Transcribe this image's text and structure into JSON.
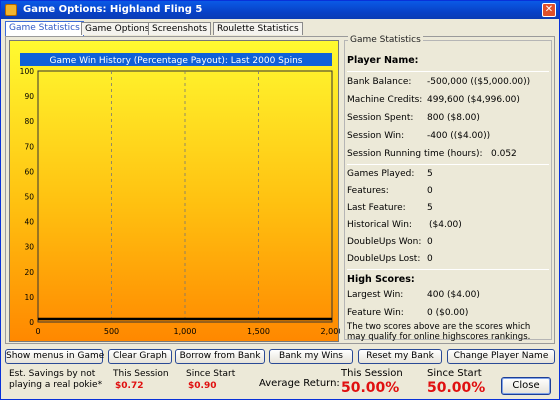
{
  "window": {
    "title": "Game Options: Highland Fling 5",
    "close_glyph": "✕"
  },
  "tabs": [
    "Game Statistics",
    "Game Options",
    "Screenshots",
    "Roulette Statistics"
  ],
  "chart_data": {
    "type": "line",
    "title": "Game Win History (Percentage Payout): Last 2000 Spins",
    "xlim": [
      0,
      2000
    ],
    "ylim": [
      0,
      100
    ],
    "x_ticks": [
      "0",
      "500",
      "1,000",
      "1,500",
      "2,000"
    ],
    "y_ticks": [
      "0",
      "10",
      "20",
      "30",
      "40",
      "50",
      "60",
      "70",
      "80",
      "90",
      "100"
    ],
    "series": [
      {
        "x": [
          0,
          2000
        ],
        "values": [
          0,
          0
        ]
      }
    ],
    "grid": true
  },
  "stats": {
    "group_title": "Game Statistics",
    "player_name_label": "Player Name:",
    "rows_a": [
      {
        "label": "Bank Balance:",
        "value": "-500,000 (($5,000.00))"
      },
      {
        "label": "Machine Credits:",
        "value": "499,600 ($4,996.00)"
      },
      {
        "label": "Session Spent:",
        "value": "800 ($8.00)"
      },
      {
        "label": "Session Win:",
        "value": "-400 (($4.00))"
      },
      {
        "label": "Session Running time (hours):",
        "value": "0.052"
      }
    ],
    "rows_b": [
      {
        "label": "Games Played:",
        "value": "5"
      },
      {
        "label": "Features:",
        "value": "0"
      },
      {
        "label": "Last Feature:",
        "value": "5"
      },
      {
        "label": "Historical Win:",
        "value": "($4.00)"
      },
      {
        "label": "DoubleUps Won:",
        "value": "0"
      },
      {
        "label": "DoubleUps Lost:",
        "value": "0"
      }
    ],
    "high_scores_label": "High Scores:",
    "rows_c": [
      {
        "label": "Largest Win:",
        "value": "400 ($4.00)"
      },
      {
        "label": "Feature Win:",
        "value": "0 ($0.00)"
      }
    ],
    "note": "The two scores above are the scores which may qualify for online highscores rankings."
  },
  "buttons": [
    "Show menus in Game",
    "Clear Graph",
    "Borrow from Bank",
    "Bank my Wins",
    "Reset my Bank",
    "Change Player Name"
  ],
  "footer": {
    "savings_label_1": "Est. Savings by not",
    "savings_label_2": "playing a real pokie*",
    "this_session_label": "This Session",
    "this_session_value": "$0.72",
    "since_start_label": "Since Start",
    "since_start_value": "$0.90",
    "avg_return_label": "Average Return:",
    "avg_this_session_label": "This Session",
    "avg_this_session_value": "50.00%",
    "avg_since_start_label": "Since Start",
    "avg_since_start_value": "50.00%",
    "close_label": "Close"
  }
}
